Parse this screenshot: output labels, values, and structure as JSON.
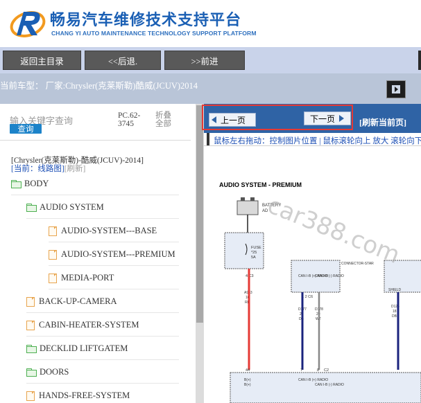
{
  "header": {
    "title": "畅易汽车维修技术支持平台",
    "subtitle": "CHANG YI AUTO MAINTENANCE TECHNOLOGY SUPPORT PLATFORM"
  },
  "toolbar": {
    "home_label": "返回主目录",
    "back_label": "<<后退.",
    "forward_label": ">>前进"
  },
  "car_info": "当前车型：  厂家:Chrysler(克莱斯勒)酷威(JCUV)2014",
  "left_panel": {
    "search_placeholder": "输入关键字查询",
    "search_button": "查询",
    "pc_code": "PC.62-3745",
    "collapse_all": "折叠全部",
    "model_line": "[Chrysler(克莱斯勒)-酷威(JCUV)-2014]",
    "current_label": "[当前：线路图]",
    "refresh_link": "[刷新]",
    "tree": [
      {
        "label": "BODY",
        "type": "folder"
      },
      {
        "label": "AUDIO SYSTEM",
        "type": "folder"
      },
      {
        "label": "AUDIO-SYSTEM---BASE",
        "type": "file"
      },
      {
        "label": "AUDIO-SYSTEM---PREMIUM",
        "type": "file"
      },
      {
        "label": "MEDIA-PORT",
        "type": "file"
      },
      {
        "label": "BACK-UP-CAMERA",
        "type": "file"
      },
      {
        "label": "CABIN-HEATER-SYSTEM",
        "type": "file"
      },
      {
        "label": "DECKLID LIFTGATEM",
        "type": "folder"
      },
      {
        "label": "DOORS",
        "type": "folder"
      },
      {
        "label": "HANDS-FREE-SYSTEM",
        "type": "file"
      }
    ]
  },
  "viewer": {
    "prev_label": "上一页",
    "next_label": "下一页",
    "refresh_label": "[刷新当前页]",
    "hint": "鼠标左右拖动：控制图片位置 | 鼠标滚轮向上 放大  滚轮向下 缩小",
    "watermark": "car388.com",
    "diagram": {
      "title": "AUDIO SYSTEM - PREMIUM",
      "battery_label": "BATTERY",
      "ad_label": "AD",
      "fuse_label": "FUSE",
      "fuse_amp": "*25",
      "fuse_rating": "5A",
      "c3_label": "4  C3",
      "wire_a": "A933",
      "wire_a_gauge": "16",
      "wire_a_color": "RD",
      "connector_star": "CONNECTOR-STAR",
      "can_left": "CAN I-B (+) RADIO",
      "can_right": "CAN I-B (-) RADIO",
      "pins_top": "1  2  C6",
      "wire_d177": "D177",
      "wire_d177_gauge": "20",
      "wire_d177_color": "DB",
      "wire_d178": "D178",
      "wire_d178_gauge": "20",
      "wire_d178_color": "WT",
      "shield_label": "SHIELD",
      "wire_d126": "D126",
      "wire_d126_gauge": "18",
      "wire_d126_color": "DB",
      "pins_bottom_left": "44",
      "pins_bottom_mid": "7",
      "pins_bottom_mid2": "8",
      "pins_bottom_c2": "C2",
      "b_plus": "B(+)",
      "b_plus_sub": "B(+)",
      "radio_can_left": "CAN I-B (+) RADIO",
      "radio_can_right": "CAN I-B (-) RADIO"
    }
  },
  "colors": {
    "toolbar_bg": "#c9d3ea",
    "button_bg": "#595959",
    "nav_blue": "#2f63a5",
    "highlight_red": "#e53935",
    "link_blue": "#1c4fb5"
  }
}
